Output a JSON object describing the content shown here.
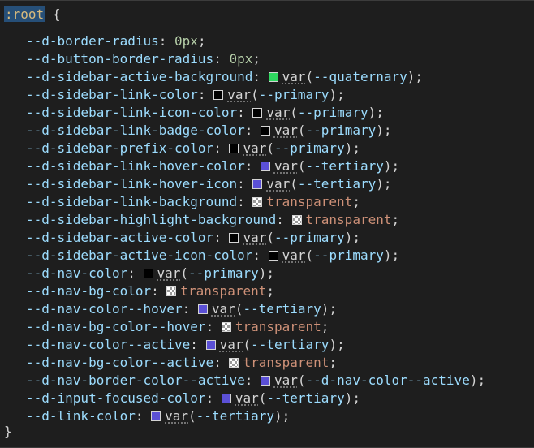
{
  "selector": ":root",
  "open_brace": "{",
  "close_brace": "}",
  "colors": {
    "quaternary": "#2fd760",
    "primary": "#000000",
    "tertiary": "#5b50d6"
  },
  "declarations": [
    {
      "prop": "--d-border-radius",
      "value": "0px",
      "kind": "num"
    },
    {
      "prop": "--d-button-border-radius",
      "value": "0px",
      "kind": "num"
    },
    {
      "prop": "--d-sidebar-active-background",
      "value": "--quaternary",
      "kind": "var",
      "swatch": "#2fd760"
    },
    {
      "prop": "--d-sidebar-link-color",
      "value": "--primary",
      "kind": "var",
      "swatch": "#000000"
    },
    {
      "prop": "--d-sidebar-link-icon-color",
      "value": "--primary",
      "kind": "var",
      "swatch": "#000000"
    },
    {
      "prop": "--d-sidebar-link-badge-color",
      "value": "--primary",
      "kind": "var",
      "swatch": "#000000"
    },
    {
      "prop": "--d-sidebar-prefix-color",
      "value": "--primary",
      "kind": "var",
      "swatch": "#000000"
    },
    {
      "prop": "--d-sidebar-link-hover-color",
      "value": "--tertiary",
      "kind": "var",
      "swatch": "#5b50d6"
    },
    {
      "prop": "--d-sidebar-link-hover-icon",
      "value": "--tertiary",
      "kind": "var",
      "swatch": "#5b50d6"
    },
    {
      "prop": "--d-sidebar-link-background",
      "value": "transparent",
      "kind": "transparent"
    },
    {
      "prop": "--d-sidebar-highlight-background",
      "value": "transparent",
      "kind": "transparent"
    },
    {
      "prop": "--d-sidebar-active-color",
      "value": "--primary",
      "kind": "var",
      "swatch": "#000000"
    },
    {
      "prop": "--d-sidebar-active-icon-color",
      "value": "--primary",
      "kind": "var",
      "swatch": "#000000"
    },
    {
      "prop": "--d-nav-color",
      "value": "--primary",
      "kind": "var",
      "swatch": "#000000"
    },
    {
      "prop": "--d-nav-bg-color",
      "value": "transparent",
      "kind": "transparent"
    },
    {
      "prop": "--d-nav-color--hover",
      "value": "--tertiary",
      "kind": "var",
      "swatch": "#5b50d6"
    },
    {
      "prop": "--d-nav-bg-color--hover",
      "value": "transparent",
      "kind": "transparent"
    },
    {
      "prop": "--d-nav-color--active",
      "value": "--tertiary",
      "kind": "var",
      "swatch": "#5b50d6"
    },
    {
      "prop": "--d-nav-bg-color--active",
      "value": "transparent",
      "kind": "transparent"
    },
    {
      "prop": "--d-nav-border-color--active",
      "value": "--d-nav-color--active",
      "kind": "var",
      "swatch": "#5b50d6"
    },
    {
      "prop": "--d-input-focused-color",
      "value": "--tertiary",
      "kind": "var",
      "swatch": "#5b50d6"
    },
    {
      "prop": "--d-link-color",
      "value": "--tertiary",
      "kind": "var",
      "swatch": "#5b50d6"
    }
  ]
}
